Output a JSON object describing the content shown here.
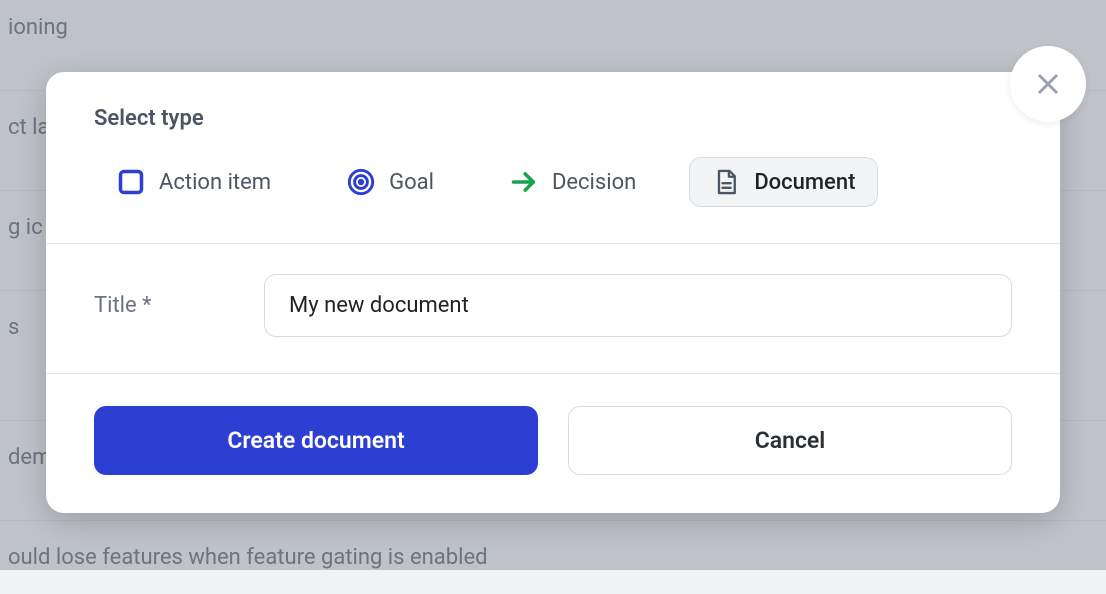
{
  "background": {
    "lines": [
      "ioning",
      "ct la",
      "g ic",
      "s",
      "dem",
      "ould lose features when feature gating is enabled"
    ]
  },
  "modal": {
    "selectTypeLabel": "Select type",
    "types": {
      "actionItem": "Action item",
      "goal": "Goal",
      "decision": "Decision",
      "document": "Document"
    },
    "titleLabel": "Title *",
    "titleValue": "My new document",
    "createButton": "Create document",
    "cancelButton": "Cancel"
  }
}
